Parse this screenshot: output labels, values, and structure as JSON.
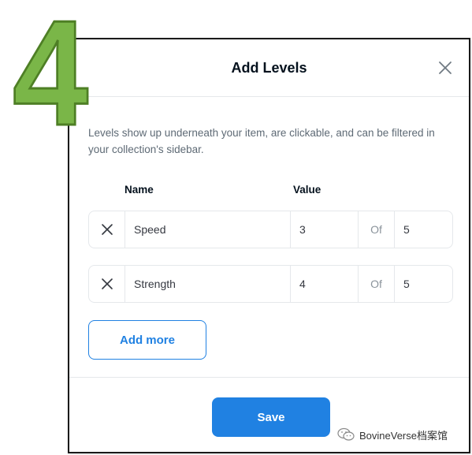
{
  "step_number": "4",
  "dialog": {
    "title": "Add Levels",
    "description": "Levels show up underneath your item, are clickable, and can be filtered in your collection's sidebar.",
    "columns": {
      "name": "Name",
      "value": "Value"
    },
    "levels": [
      {
        "name": "Speed",
        "value": "3",
        "of_label": "Of",
        "max": "5"
      },
      {
        "name": "Strength",
        "value": "4",
        "of_label": "Of",
        "max": "5"
      }
    ],
    "add_more_label": "Add more",
    "save_label": "Save"
  },
  "colors": {
    "accent": "#2081e2",
    "step_number_fill": "#7ab648",
    "border": "#e5e8eb",
    "muted_text": "#5e6a75"
  },
  "icons": {
    "close": "close-icon",
    "remove": "x-icon",
    "watermark": "wechat-icon"
  },
  "watermark": {
    "text": "BovineVerse档案馆"
  }
}
